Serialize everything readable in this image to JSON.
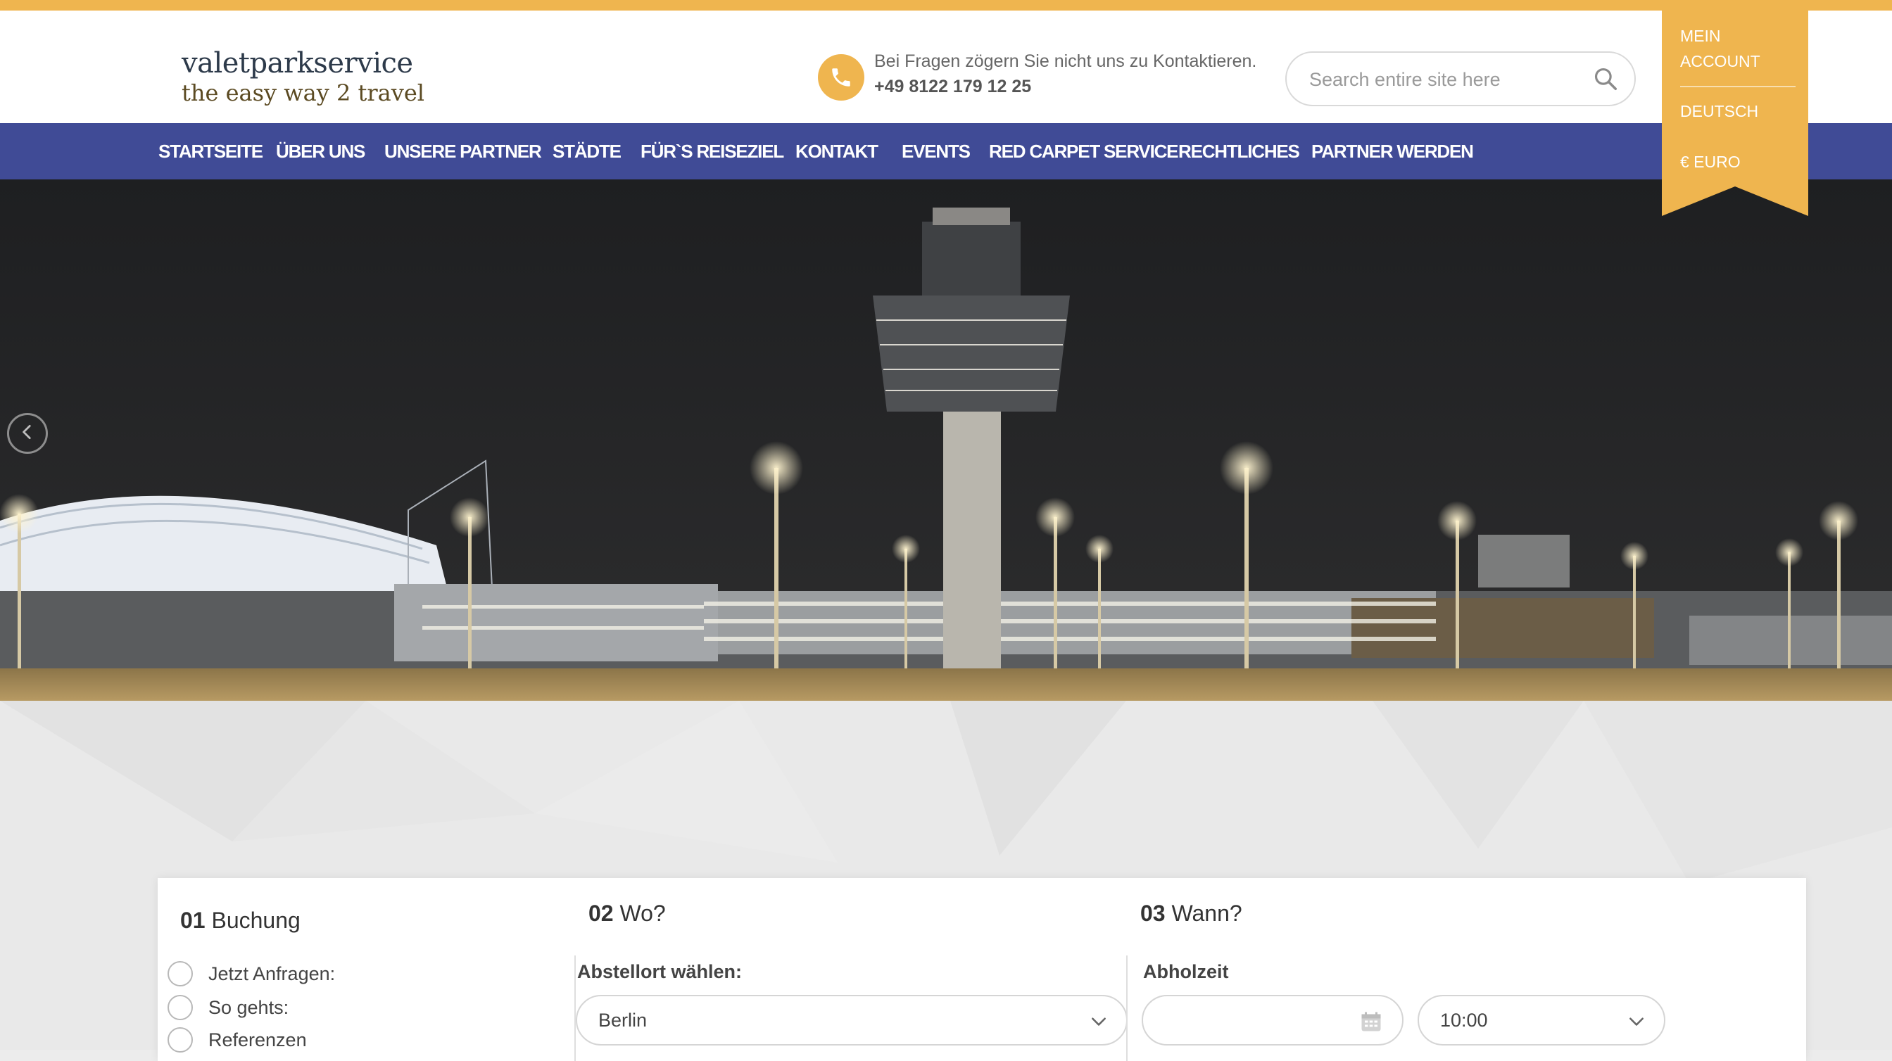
{
  "brand": {
    "name": "valetparkservice",
    "tagline": "the easy way 2 travel"
  },
  "contact": {
    "text": "Bei Fragen zögern Sie nicht uns zu Kontaktieren.",
    "phone": "+49 8122 179 12 25"
  },
  "search": {
    "placeholder": "Search entire site here"
  },
  "nav": {
    "items": [
      {
        "label": "STARTSEITE"
      },
      {
        "label": "ÜBER UNS"
      },
      {
        "label": "UNSERE PARTNER"
      },
      {
        "label": "STÄDTE"
      },
      {
        "label": "FÜR`S REISEZIEL"
      },
      {
        "label": "KONTAKT"
      },
      {
        "label": "EVENTS"
      },
      {
        "label": "RED CARPET SERVICE"
      },
      {
        "label": "RECHTLICHES"
      },
      {
        "label": "PARTNER WERDEN"
      }
    ]
  },
  "account_menu": {
    "account_line1": "MEIN",
    "account_line2": "ACCOUNT",
    "language": "DEUTSCH",
    "currency": "€ EURO"
  },
  "booking": {
    "section1": {
      "num": "01",
      "title": "Buchung"
    },
    "options": [
      "Jetzt Anfragen:",
      "So gehts:",
      "Referenzen"
    ],
    "section2": {
      "num": "02",
      "title": "Wo?"
    },
    "location_label": "Abstellort wählen:",
    "location_value": "Berlin",
    "section3": {
      "num": "03",
      "title": "Wann?"
    },
    "pickup_label": "Abholzeit",
    "pickup_date": "",
    "pickup_time": "10:00"
  },
  "colors": {
    "accent": "#efb54f",
    "nav_bg": "#404b96",
    "header_bg": "#ffffff"
  },
  "icons": {
    "phone": "phone-icon",
    "search": "search-icon",
    "prev": "chevron-left-icon",
    "calendar": "calendar-icon",
    "dropdown": "chevron-down-icon"
  }
}
